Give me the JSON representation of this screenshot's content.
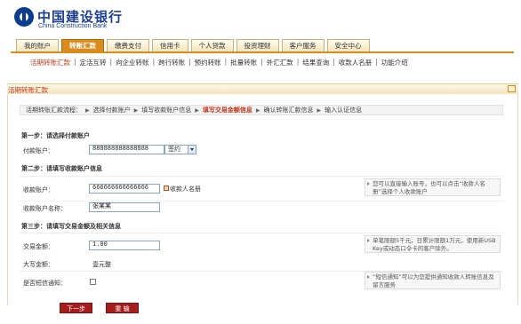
{
  "brand": {
    "name_cn": "中国建设银行",
    "name_en": "China Construction Bank"
  },
  "tabs": [
    {
      "label": "我的账户",
      "active": false
    },
    {
      "label": "转账汇款",
      "active": true
    },
    {
      "label": "缴费支付",
      "active": false
    },
    {
      "label": "信用卡",
      "active": false
    },
    {
      "label": "个人贷款",
      "active": false
    },
    {
      "label": "投资理财",
      "active": false
    },
    {
      "label": "客户服务",
      "active": false
    },
    {
      "label": "安全中心",
      "active": false
    }
  ],
  "subnav": [
    {
      "label": "活期转账汇款",
      "active": true
    },
    {
      "label": "定活互转",
      "active": false
    },
    {
      "label": "向企业转账",
      "active": false
    },
    {
      "label": "跨行转账",
      "active": false
    },
    {
      "label": "预约转账",
      "active": false
    },
    {
      "label": "批量转账",
      "active": false
    },
    {
      "label": "外汇汇款",
      "active": false
    },
    {
      "label": "结果查询",
      "active": false
    },
    {
      "label": "收款人名册",
      "active": false
    },
    {
      "label": "功能介绍",
      "active": false
    }
  ],
  "panel": {
    "title": "活期转账汇款"
  },
  "flow": {
    "prefix": "活期转账汇款流程：",
    "steps": [
      "选择付款账户",
      "填写收款账户信息",
      "填写交易金额信息",
      "确认转账汇款信息",
      "输入认证信息"
    ],
    "current_index": 2
  },
  "step1": {
    "title": "第一步：请选择付款账户",
    "account_label": "付款账户：",
    "account_value": "888888888888888",
    "account_type": "签约"
  },
  "step2": {
    "title": "第二步：请填写收款账户信息",
    "payee_account_label": "收款账户：",
    "payee_account_value": "666666666666666",
    "payee_book_link": "收款人名册",
    "payee_name_label": "收款账户名称：",
    "payee_name_value": "张某某",
    "hint": "您可以直接输入账号，也可以点击“收款人名册”选择个人收款账户"
  },
  "step3": {
    "title": "第三步：请填写交易金额及相关信息",
    "amount_label": "交易金额：",
    "amount_value": "1.00",
    "amount_hint": "单笔限额5千元，日累计限额1万元，使用新USB Key或动态口令卡的客户除外。",
    "uppercase_label": "大写金额：",
    "uppercase_value": "壹元整",
    "sms_label": "是否短信通知：",
    "sms_checked": false,
    "sms_hint": "“短信通知”可以为您提供通知收款人转账信息及留言服务"
  },
  "buttons": {
    "next": "下一步",
    "reset": "重 输"
  },
  "colors": {
    "accent": "#d98b1c",
    "highlight": "#c0391b",
    "button": "#a51d1d",
    "brand": "#1d3f8c"
  }
}
